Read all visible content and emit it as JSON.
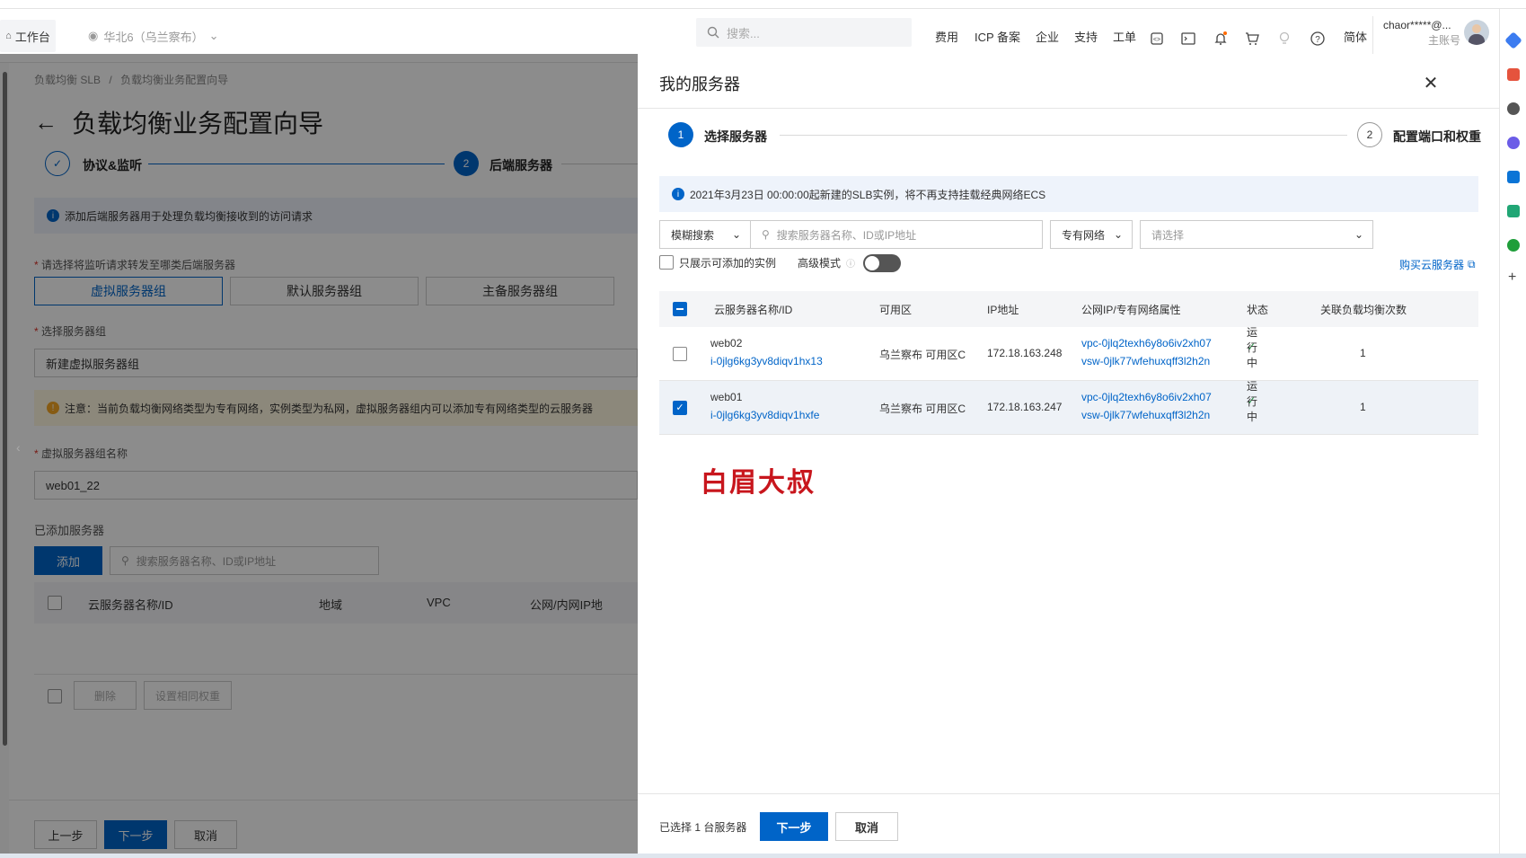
{
  "topbar": {
    "workspace": "工作台",
    "region": "华北6（乌兰察布）",
    "search_placeholder": "搜索...",
    "nav": [
      "费用",
      "ICP 备案",
      "企业",
      "支持",
      "工单"
    ],
    "lang": "简体",
    "user": "chaor*****@...",
    "role": "主账号",
    "icons": [
      "workspace-home-icon",
      "location-icon",
      "chevron-down-icon",
      "search-icon",
      "code-icon",
      "terminal-icon",
      "bell-icon",
      "cart-icon",
      "bulb-icon",
      "help-icon",
      "avatar"
    ]
  },
  "background": {
    "breadcrumb": [
      "负载均衡 SLB",
      "/",
      "负载均衡业务配置向导"
    ],
    "title": "负载均衡业务配置向导",
    "steps": [
      {
        "num": "✓",
        "label": "协议&监听"
      },
      {
        "num": "2",
        "label": "后端服务器"
      }
    ],
    "info": "添加后端服务器用于处理负载均衡接收到的访问请求",
    "group_question": "请选择将监听请求转发至哪类后端服务器",
    "group_tabs": [
      "虚拟服务器组",
      "默认服务器组",
      "主备服务器组"
    ],
    "select_group_label": "选择服务器组",
    "select_group_value": "新建虚拟服务器组",
    "warning": "注意：当前负载均衡网络类型为专有网络，实例类型为私网，虚拟服务器组内可以添加专有网络类型的云服务器",
    "group_name_label": "虚拟服务器组名称",
    "group_name_value": "web01_22",
    "added_label": "已添加服务器",
    "add_button": "添加",
    "search_placeholder": "搜索服务器名称、ID或IP地址",
    "table_headers": [
      "云服务器名称/ID",
      "地域",
      "VPC",
      "公网/内网IP地"
    ],
    "delete_button": "删除",
    "weight_button": "设置相同权重",
    "prev_button": "上一步",
    "next_button": "下一步",
    "cancel_button": "取消"
  },
  "panel": {
    "title": "我的服务器",
    "steps": [
      {
        "num": "1",
        "label": "选择服务器"
      },
      {
        "num": "2",
        "label": "配置端口和权重"
      }
    ],
    "info": "2021年3月23日 00:00:00起新建的SLB实例，将不再支持挂载经典网络ECS",
    "search_type": "模糊搜索",
    "search_placeholder": "搜索服务器名称、ID或IP地址",
    "network_type": "专有网络",
    "vpc_placeholder": "请选择",
    "only_available": "只展示可添加的实例",
    "advanced_mode": "高级模式",
    "buy_link": "购买云服务器",
    "headers": [
      "云服务器名称/ID",
      "可用区",
      "IP地址",
      "公网IP/专有网络属性",
      "状态",
      "关联负载均衡次数"
    ],
    "rows": [
      {
        "name": "web02",
        "id": "i-0jlg6kg3yv8diqv1hx13",
        "zone": "乌兰察布 可用区C",
        "ip": "172.18.163.248",
        "vpc": "vpc-0jlq2texh6y8o6iv2xh07",
        "vsw": "vsw-0jlk77wfehuxqff3l2h2n",
        "status": "运行中",
        "count": "1",
        "checked": false
      },
      {
        "name": "web01",
        "id": "i-0jlg6kg3yv8diqv1hxfe",
        "zone": "乌兰察布 可用区C",
        "ip": "172.18.163.247",
        "vpc": "vpc-0jlq2texh6y8o6iv2xh07",
        "vsw": "vsw-0jlk77wfehuxqff3l2h2n",
        "status": "运行中",
        "count": "1",
        "checked": true
      }
    ],
    "watermark": "白眉大叔",
    "selected_text": "已选择 1 台服务器",
    "next_button": "下一步",
    "cancel_button": "取消"
  },
  "colors": {
    "primary": "#0064c8",
    "success": "#1e8e3e",
    "warning_bg": "#fff7e0",
    "info_bg": "#eef3fb",
    "watermark": "#c8161d"
  }
}
